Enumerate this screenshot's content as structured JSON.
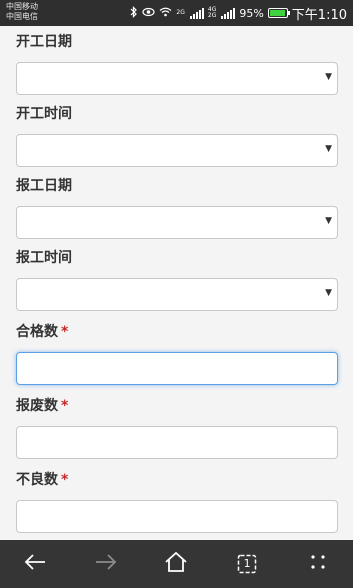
{
  "status_bar": {
    "carrier_1": "中国移动",
    "carrier_2": "中国电信",
    "net_1_top": "2G",
    "net_2_top": "4G",
    "net_2_bottom": "2G",
    "battery": "95%",
    "time": "下午1:10"
  },
  "form": {
    "fields": [
      {
        "label": "开工日期",
        "type": "select",
        "value": ""
      },
      {
        "label": "开工时间",
        "type": "select",
        "value": ""
      },
      {
        "label": "报工日期",
        "type": "select",
        "value": ""
      },
      {
        "label": "报工时间",
        "type": "select",
        "value": ""
      },
      {
        "label": "合格数",
        "type": "input",
        "required": "*",
        "value": "",
        "focused": true
      },
      {
        "label": "报废数",
        "type": "input",
        "required": "*",
        "value": ""
      },
      {
        "label": "不良数",
        "type": "input",
        "required": "*",
        "value": ""
      }
    ]
  },
  "navbar": {
    "tabs_count": "1",
    "icons": [
      "back-arrow-icon",
      "forward-arrow-icon",
      "home-icon",
      "tabs-icon",
      "menu-icon"
    ]
  }
}
